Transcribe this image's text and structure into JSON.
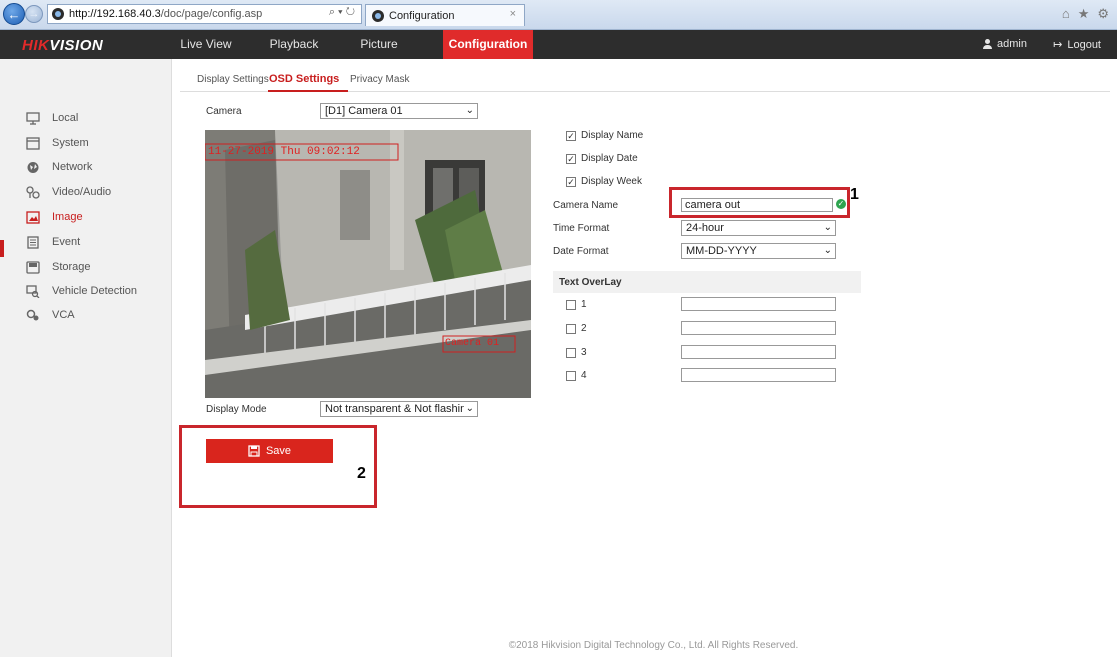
{
  "browser": {
    "address_host": "http://192.168.40.3",
    "address_path": "/doc/page/config.asp",
    "address_tools": "⌕ ▾ ↻",
    "tab_title": "Configuration",
    "tab_close": "×"
  },
  "topnav": {
    "logo_prefix": "HIK",
    "logo_suffix": "VISION",
    "items": [
      "Live View",
      "Playback",
      "Picture",
      "Configuration"
    ],
    "user": "admin",
    "logout": "Logout"
  },
  "sidebar": {
    "items": [
      "Local",
      "System",
      "Network",
      "Video/Audio",
      "Image",
      "Event",
      "Storage",
      "Vehicle Detection",
      "VCA"
    ],
    "active": "Image"
  },
  "subtabs": [
    "Display Settings",
    "OSD Settings",
    "Privacy Mask"
  ],
  "camera": {
    "label": "Camera",
    "value": "[D1] Camera 01"
  },
  "osd_preview": {
    "date_text": "11-27-2019 Thu 09:02:12",
    "name_text": "Camera 01"
  },
  "display_mode": {
    "label": "Display Mode",
    "value": "Not transparent & Not flashing"
  },
  "options": {
    "display_name": "Display Name",
    "display_date": "Display Date",
    "display_week": "Display Week"
  },
  "camera_name": {
    "label": "Camera Name",
    "value": "camera out"
  },
  "time_format": {
    "label": "Time Format",
    "value": "24-hour"
  },
  "date_format": {
    "label": "Date Format",
    "value": "MM-DD-YYYY"
  },
  "text_overlay": {
    "title": "Text OverLay",
    "rows": [
      "1",
      "2",
      "3",
      "4"
    ]
  },
  "save_label": "Save",
  "annotations": {
    "one": "1",
    "two": "2"
  },
  "footer": "©2018 Hikvision Digital Technology Co., Ltd. All Rights Reserved.",
  "colors": {
    "accent": "#e02b2b",
    "nav_bg": "#2d2d2d",
    "annotation": "#c9262c",
    "ok": "#2ea44f"
  }
}
